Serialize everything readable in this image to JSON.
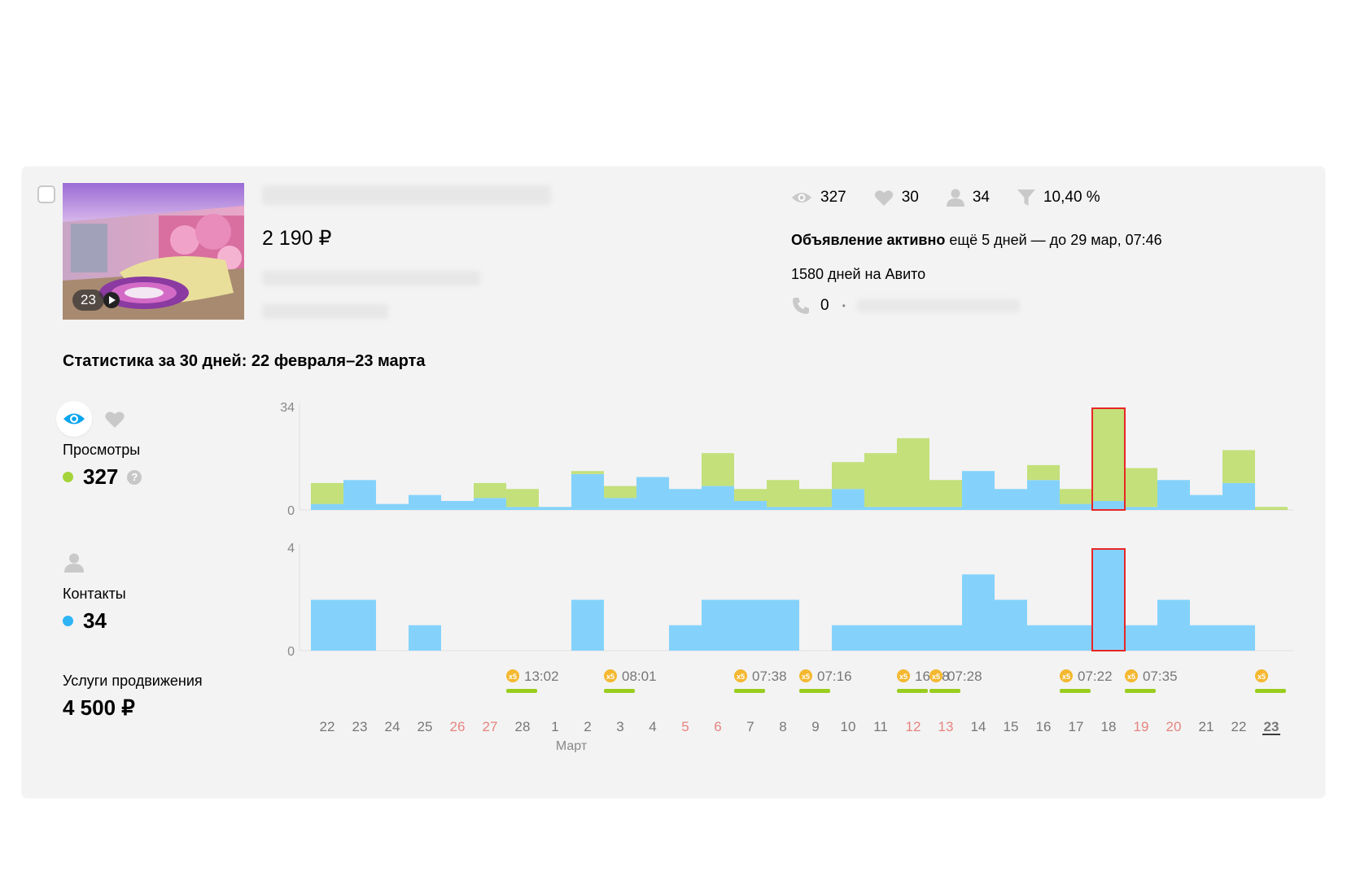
{
  "listing": {
    "photo_count": "23",
    "price": "2 190 ₽",
    "stats": {
      "views": "327",
      "favorites": "30",
      "contacts": "34",
      "conversion": "10,40 %"
    },
    "active_bold": "Объявление активно",
    "active_rest": " ещё 5 дней — до 29 мар, 07:46",
    "days_on_avito": "1580 дней на Авито",
    "calls": "0",
    "separator": "•"
  },
  "stats_section": {
    "title": "Статистика за 30 дней: 22 февраля–23 марта",
    "views": {
      "label": "Просмотры",
      "value": "327",
      "dot_color": "#a5d43a",
      "help": "?"
    },
    "contacts": {
      "label": "Контакты",
      "value": "34",
      "dot_color": "#2db4f5"
    },
    "promo": {
      "label": "Услуги продвижения",
      "value": "4 500 ₽"
    }
  },
  "colors": {
    "green": "#c3e07a",
    "blue": "#84d2fb",
    "highlight": "#e82626",
    "weekend": "#e5847f",
    "promo_bar": "#9acd1f",
    "promo_coin": "#f4b830"
  },
  "chart_data": [
    {
      "type": "bar",
      "title": "Просмотры",
      "ylim": [
        0,
        34
      ],
      "y_ticks": [
        "34",
        "0"
      ],
      "categories": [
        "22",
        "23",
        "24",
        "25",
        "26",
        "27",
        "28",
        "1",
        "2",
        "3",
        "4",
        "5",
        "6",
        "7",
        "8",
        "9",
        "10",
        "11",
        "12",
        "13",
        "14",
        "15",
        "16",
        "17",
        "18",
        "19",
        "20",
        "21",
        "22",
        "23"
      ],
      "series": [
        {
          "color": "#84d2fb",
          "values": [
            2,
            10,
            2,
            5,
            3,
            4,
            1,
            1,
            12,
            4,
            11,
            7,
            8,
            3,
            1,
            1,
            7,
            1,
            1,
            1,
            13,
            7,
            10,
            2,
            3,
            1,
            10,
            5,
            9,
            0
          ]
        },
        {
          "color": "#c3e07a",
          "values": [
            7,
            0,
            0,
            0,
            0,
            5,
            6,
            0,
            1,
            4,
            0,
            0,
            11,
            4,
            9,
            6,
            9,
            18,
            23,
            9,
            0,
            0,
            5,
            5,
            31,
            13,
            0,
            0,
            11,
            1
          ]
        }
      ],
      "highlight_category_index": 24
    },
    {
      "type": "bar",
      "title": "Контакты",
      "ylim": [
        0,
        4
      ],
      "y_ticks": [
        "4",
        "0"
      ],
      "categories": [
        "22",
        "23",
        "24",
        "25",
        "26",
        "27",
        "28",
        "1",
        "2",
        "3",
        "4",
        "5",
        "6",
        "7",
        "8",
        "9",
        "10",
        "11",
        "12",
        "13",
        "14",
        "15",
        "16",
        "17",
        "18",
        "19",
        "20",
        "21",
        "22",
        "23"
      ],
      "series": [
        {
          "color": "#84d2fb",
          "values": [
            2,
            2,
            0,
            1,
            0,
            0,
            0,
            0,
            2,
            0,
            0,
            1,
            2,
            2,
            2,
            0,
            1,
            1,
            1,
            1,
            3,
            2,
            1,
            1,
            4,
            1,
            2,
            1,
            1,
            0
          ]
        }
      ],
      "highlight_category_index": 24
    }
  ],
  "x_axis": {
    "labels": [
      "22",
      "23",
      "24",
      "25",
      "26",
      "27",
      "28",
      "1",
      "2",
      "3",
      "4",
      "5",
      "6",
      "7",
      "8",
      "9",
      "10",
      "11",
      "12",
      "13",
      "14",
      "15",
      "16",
      "17",
      "18",
      "19",
      "20",
      "21",
      "22",
      "23"
    ],
    "weekend": [
      false,
      false,
      false,
      false,
      true,
      true,
      false,
      false,
      false,
      false,
      false,
      true,
      true,
      false,
      false,
      false,
      false,
      false,
      true,
      true,
      false,
      false,
      false,
      false,
      false,
      true,
      true,
      false,
      false,
      false
    ],
    "current_index": 29,
    "month_label": "Март",
    "month_label_index": 8
  },
  "promotions": [
    {
      "day_index": 6,
      "badge": "x5",
      "time": "13:02"
    },
    {
      "day_index": 9,
      "badge": "x5",
      "time": "08:01"
    },
    {
      "day_index": 13,
      "badge": "x5",
      "time": "07:38"
    },
    {
      "day_index": 15,
      "badge": "x5",
      "time": "07:16"
    },
    {
      "day_index": 18,
      "badge": "x5",
      "time": "16:38"
    },
    {
      "day_index": 19,
      "badge": "x5",
      "time": "07:28"
    },
    {
      "day_index": 23,
      "badge": "x5",
      "time": "07:22"
    },
    {
      "day_index": 25,
      "badge": "x5",
      "time": "07:35"
    },
    {
      "day_index": 29,
      "badge": "x5",
      "time": ""
    }
  ]
}
